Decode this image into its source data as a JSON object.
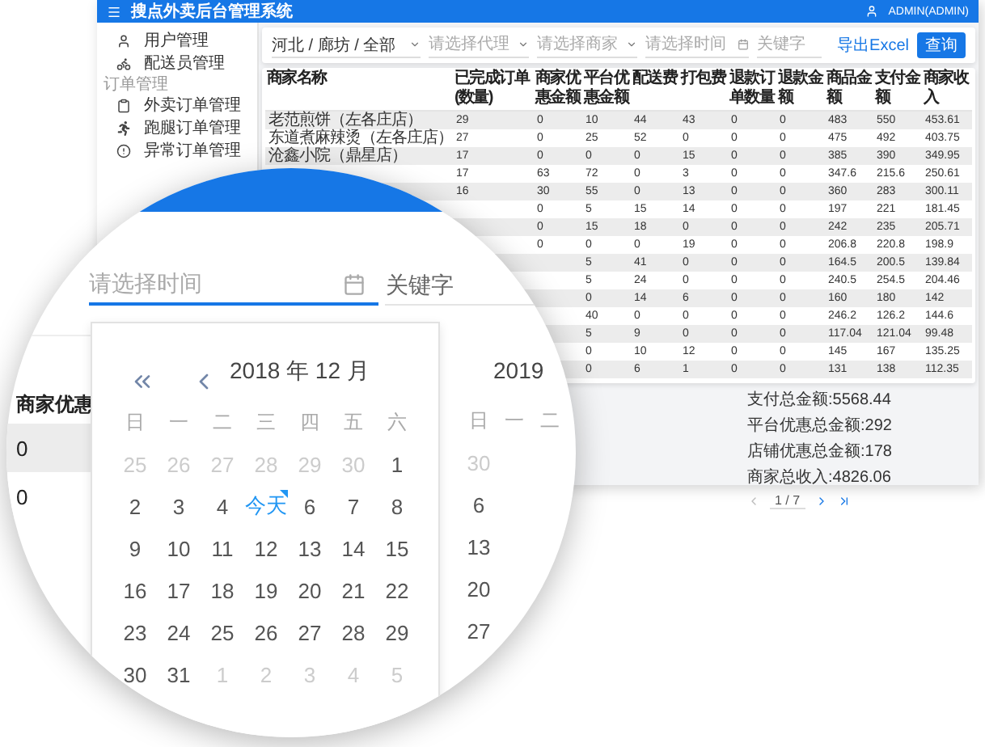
{
  "header": {
    "title": "搜点外卖后台管理系统",
    "user": "ADMIN(ADMIN)"
  },
  "sidebar": {
    "groups": [
      {
        "items": [
          {
            "label": "用户管理",
            "kind": "user"
          },
          {
            "label": "配送员管理",
            "kind": "courier"
          }
        ]
      },
      {
        "heading": "订单管理",
        "items": [
          {
            "label": "外卖订单管理",
            "kind": "delivery"
          },
          {
            "label": "跑腿订单管理",
            "kind": "errand"
          },
          {
            "label": "异常订单管理",
            "kind": "exception"
          }
        ]
      }
    ]
  },
  "filters": [
    {
      "kind": "select",
      "value": "河北 / 廊坊 / 全部"
    },
    {
      "kind": "select",
      "placeholder": "请选择代理"
    },
    {
      "kind": "select",
      "placeholder": "请选择商家"
    },
    {
      "kind": "date",
      "placeholder": "请选择时间"
    },
    {
      "kind": "text",
      "placeholder": "关键字"
    }
  ],
  "export_link": "导出Excel",
  "query_button": "查询",
  "table": {
    "columns": [
      "商家名称",
      "已完成订单(数量)",
      "商家优惠金额",
      "平台优惠金额",
      "配送费",
      "打包费",
      "退款订单数量",
      "退款金额",
      "商品金额",
      "支付金额",
      "商家收入"
    ],
    "rows": [
      {
        "cells": [
          "老范煎饼（左各庄店）",
          "29",
          "0",
          "10",
          "44",
          "43",
          "0",
          "0",
          "483",
          "550",
          "453.61"
        ]
      },
      {
        "cells": [
          "东道煮麻辣烫（左各庄店）",
          "27",
          "0",
          "25",
          "52",
          "0",
          "0",
          "0",
          "475",
          "492",
          "403.75"
        ]
      },
      {
        "cells": [
          "沧鑫小院（鼎星店）",
          "17",
          "0",
          "0",
          "0",
          "15",
          "0",
          "0",
          "385",
          "390",
          "349.95"
        ]
      },
      {
        "cells": [
          "17",
          "63",
          "72",
          "0",
          "3",
          "0",
          "0",
          "347.6",
          "215.6",
          "250.61"
        ]
      },
      {
        "cells": [
          "16",
          "30",
          "55",
          "0",
          "13",
          "0",
          "0",
          "360",
          "283",
          "300.11"
        ]
      },
      {
        "cells": [
          "0",
          "5",
          "15",
          "14",
          "0",
          "0",
          "197",
          "221",
          "181.45"
        ]
      },
      {
        "cells": [
          "0",
          "15",
          "18",
          "0",
          "0",
          "0",
          "242",
          "235",
          "205.71"
        ]
      },
      {
        "cells": [
          "0",
          "0",
          "0",
          "19",
          "0",
          "0",
          "206.8",
          "220.8",
          "198.9"
        ]
      },
      {
        "cells": [
          "5",
          "41",
          "0",
          "0",
          "0",
          "164.5",
          "200.5",
          "139.84"
        ]
      },
      {
        "cells": [
          "5",
          "24",
          "0",
          "0",
          "0",
          "240.5",
          "254.5",
          "204.46"
        ]
      },
      {
        "cells": [
          "0",
          "14",
          "6",
          "0",
          "0",
          "160",
          "180",
          "142"
        ]
      },
      {
        "cells": [
          "40",
          "0",
          "0",
          "0",
          "0",
          "246.2",
          "126.2",
          "144.6"
        ]
      },
      {
        "cells": [
          "5",
          "9",
          "0",
          "0",
          "0",
          "117.04",
          "121.04",
          "99.48"
        ]
      },
      {
        "cells": [
          "0",
          "10",
          "12",
          "0",
          "0",
          "145",
          "167",
          "135.25"
        ]
      },
      {
        "cells": [
          "0",
          "6",
          "1",
          "0",
          "0",
          "131",
          "138",
          "112.35"
        ]
      }
    ]
  },
  "totals": [
    "支付总金额:5568.44",
    "平台优惠总金额:292",
    "店铺优惠总金额:178",
    "商家总收入:4826.06"
  ],
  "pagination": {
    "page": "1 / 7"
  },
  "magnifier": {
    "date_field": {
      "placeholder": "请选择时间"
    },
    "keyword_field": {
      "placeholder": "关键字"
    },
    "table_fragment": {
      "header": "商家优惠",
      "cells": [
        "0",
        "0"
      ]
    },
    "calendar": {
      "title": "2018 年 12 月",
      "weekdays": [
        "日",
        "一",
        "二",
        "三",
        "四",
        "五",
        "六"
      ],
      "weeks": [
        [
          {
            "label": "25",
            "muted": true,
            "selected": false
          },
          {
            "label": "26",
            "muted": true,
            "selected": false
          },
          {
            "label": "27",
            "muted": true,
            "selected": false
          },
          {
            "label": "28",
            "muted": true,
            "selected": false
          },
          {
            "label": "29",
            "muted": true,
            "selected": false
          },
          {
            "label": "30",
            "muted": true,
            "selected": false
          },
          {
            "label": "1",
            "muted": false,
            "selected": false
          }
        ],
        [
          {
            "label": "2",
            "muted": false,
            "selected": false
          },
          {
            "label": "3",
            "muted": false,
            "selected": false
          },
          {
            "label": "4",
            "muted": false,
            "selected": false
          },
          {
            "label": "今天",
            "muted": false,
            "selected": true
          },
          {
            "label": "6",
            "muted": false,
            "selected": false
          },
          {
            "label": "7",
            "muted": false,
            "selected": false
          },
          {
            "label": "8",
            "muted": false,
            "selected": false
          }
        ],
        [
          {
            "label": "9",
            "muted": false,
            "selected": false
          },
          {
            "label": "10",
            "muted": false,
            "selected": false
          },
          {
            "label": "11",
            "muted": false,
            "selected": false
          },
          {
            "label": "12",
            "muted": false,
            "selected": false
          },
          {
            "label": "13",
            "muted": false,
            "selected": false
          },
          {
            "label": "14",
            "muted": false,
            "selected": false
          },
          {
            "label": "15",
            "muted": false,
            "selected": false
          }
        ],
        [
          {
            "label": "16",
            "muted": false,
            "selected": false
          },
          {
            "label": "17",
            "muted": false,
            "selected": false
          },
          {
            "label": "18",
            "muted": false,
            "selected": false
          },
          {
            "label": "19",
            "muted": false,
            "selected": false
          },
          {
            "label": "20",
            "muted": false,
            "selected": false
          },
          {
            "label": "21",
            "muted": false,
            "selected": false
          },
          {
            "label": "22",
            "muted": false,
            "selected": false
          }
        ],
        [
          {
            "label": "23",
            "muted": false,
            "selected": false
          },
          {
            "label": "24",
            "muted": false,
            "selected": false
          },
          {
            "label": "25",
            "muted": false,
            "selected": false
          },
          {
            "label": "26",
            "muted": false,
            "selected": false
          },
          {
            "label": "27",
            "muted": false,
            "selected": false
          },
          {
            "label": "28",
            "muted": false,
            "selected": false
          },
          {
            "label": "29",
            "muted": false,
            "selected": false
          }
        ],
        [
          {
            "label": "30",
            "muted": false,
            "selected": false
          },
          {
            "label": "31",
            "muted": false,
            "selected": false
          },
          {
            "label": "1",
            "muted": true,
            "selected": false
          },
          {
            "label": "2",
            "muted": true,
            "selected": false
          },
          {
            "label": "3",
            "muted": true,
            "selected": false
          },
          {
            "label": "4",
            "muted": true,
            "selected": false
          },
          {
            "label": "5",
            "muted": true,
            "selected": false
          }
        ]
      ]
    },
    "next_calendar": {
      "title": "2019",
      "weekdays": [
        "日",
        "一",
        "二"
      ],
      "days": [
        {
          "label": "30",
          "muted": true
        },
        {
          "label": "6",
          "muted": false
        },
        {
          "label": "13",
          "muted": false
        },
        {
          "label": "20",
          "muted": false
        },
        {
          "label": "27",
          "muted": false
        }
      ]
    }
  }
}
